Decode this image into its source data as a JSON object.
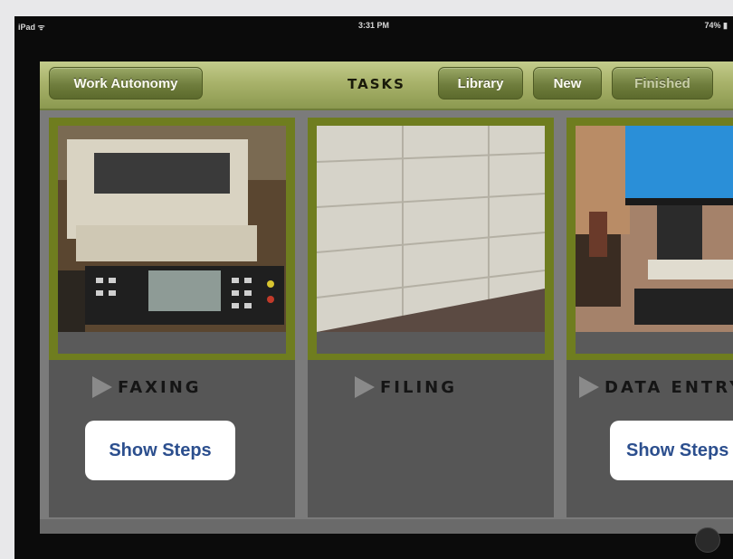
{
  "status_bar": {
    "carrier": "iPad ᯤ",
    "time": "3:31 PM",
    "battery": "74% ▮"
  },
  "nav": {
    "back_label": "Work Autonomy",
    "title": "TASKS",
    "library_label": "Library",
    "new_label": "New",
    "finished_label": "Finished"
  },
  "tasks": [
    {
      "title": "FAXING",
      "show_steps": "Show Steps",
      "photo": "fax-machine-photo"
    },
    {
      "title": "FILING",
      "photo": "file-cabinet-photo"
    },
    {
      "title": "DATA ENTRY",
      "show_steps": "Show Steps",
      "photo": "computer-desk-photo"
    }
  ],
  "colors": {
    "nav_gradient_top": "#c3cc8c",
    "button_olive": "#6f7d3d",
    "frame_olive": "#6f7d1f",
    "link_blue": "#2c4f8e"
  }
}
